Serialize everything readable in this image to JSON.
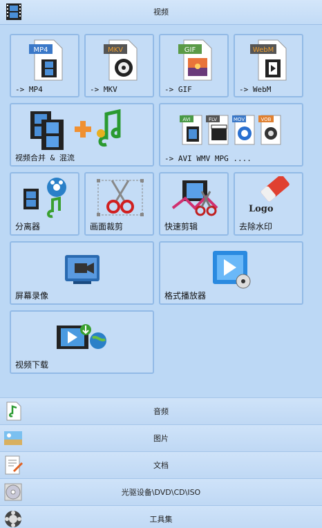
{
  "header": {
    "title": "视频",
    "icon": "film-icon"
  },
  "tiles": {
    "mp4": {
      "label": "-> MP4",
      "badge": "MP4"
    },
    "mkv": {
      "label": "-> MKV",
      "badge": "MKV"
    },
    "gif": {
      "label": "-> GIF",
      "badge": "GIF"
    },
    "webm": {
      "label": "-> WebM",
      "badge": "WebM"
    },
    "merge": {
      "label": "视频合并 & 混流"
    },
    "multi": {
      "label": "-> AVI WMV MPG ....",
      "badges": [
        "AVI",
        "FLV",
        "MOV",
        "VOB"
      ]
    },
    "split": {
      "label": "分离器"
    },
    "crop": {
      "label": "画面裁剪"
    },
    "quickcut": {
      "label": "快速剪辑"
    },
    "watermark": {
      "label": "去除水印",
      "logo_text": "Logo"
    },
    "record": {
      "label": "屏幕录像"
    },
    "player": {
      "label": "格式播放器"
    },
    "download": {
      "label": "视频下载"
    }
  },
  "categories": [
    {
      "label": "音频",
      "icon": "audio-file-icon"
    },
    {
      "label": "图片",
      "icon": "picture-icon"
    },
    {
      "label": "文档",
      "icon": "document-icon"
    },
    {
      "label": "光驱设备\\DVD\\CD\\ISO",
      "icon": "disc-icon"
    },
    {
      "label": "工具集",
      "icon": "toolset-icon"
    }
  ],
  "colors": {
    "background": "#bcd8f5",
    "tile": "#c4dcf6",
    "tile_border": "#92bae6"
  }
}
